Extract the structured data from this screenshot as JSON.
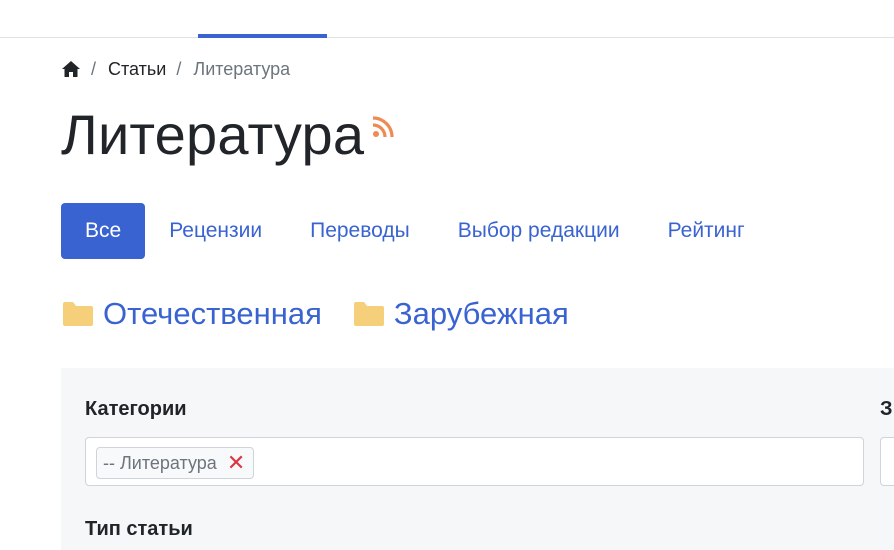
{
  "breadcrumb": {
    "home_icon": "home-icon",
    "sep1": "/",
    "link": "Статьи",
    "sep2": "/",
    "current": "Литература"
  },
  "page": {
    "title": "Литература",
    "rss_icon": "rss-icon",
    "rss_color": "#ef8a53"
  },
  "tabs": [
    {
      "label": "Все",
      "active": true
    },
    {
      "label": "Рецензии"
    },
    {
      "label": "Переводы"
    },
    {
      "label": "Выбор редакции"
    },
    {
      "label": "Рейтинг"
    }
  ],
  "folders": [
    {
      "label": "Отечественная",
      "icon": "folder-icon"
    },
    {
      "label": "Зарубежная",
      "icon": "folder-icon"
    }
  ],
  "filters": {
    "categories_label": "Категории",
    "selected_category": "-- Литература",
    "remove_symbol": "✕",
    "second_label_partial": "З",
    "type_label": "Тип статьи"
  },
  "colors": {
    "accent": "#3a63d2",
    "folder": "#f5cf79",
    "remove": "#dc3545"
  }
}
